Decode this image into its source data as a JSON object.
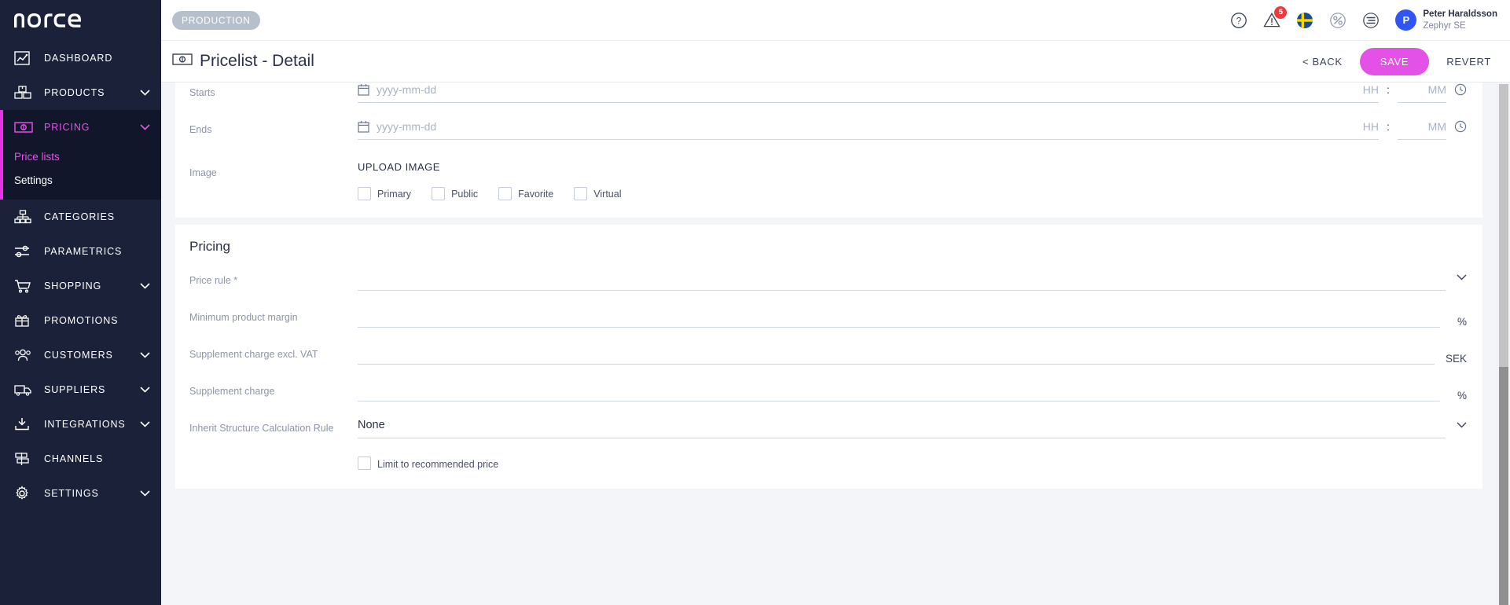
{
  "sidebar": {
    "logo": "norce",
    "items": [
      {
        "label": "DASHBOARD",
        "icon": "chart-line-icon",
        "expandable": false
      },
      {
        "label": "PRODUCTS",
        "icon": "boxes-icon",
        "expandable": true
      },
      {
        "label": "PRICING",
        "icon": "banknote-icon",
        "expandable": true,
        "active": true
      },
      {
        "label": "CATEGORIES",
        "icon": "sitemap-icon",
        "expandable": false
      },
      {
        "label": "PARAMETRICS",
        "icon": "sliders-icon",
        "expandable": false
      },
      {
        "label": "SHOPPING",
        "icon": "cart-icon",
        "expandable": true
      },
      {
        "label": "PROMOTIONS",
        "icon": "gift-icon",
        "expandable": false
      },
      {
        "label": "CUSTOMERS",
        "icon": "users-icon",
        "expandable": true
      },
      {
        "label": "SUPPLIERS",
        "icon": "truck-icon",
        "expandable": true
      },
      {
        "label": "INTEGRATIONS",
        "icon": "download-tray-icon",
        "expandable": true
      },
      {
        "label": "CHANNELS",
        "icon": "channels-icon",
        "expandable": false
      },
      {
        "label": "SETTINGS",
        "icon": "gear-icon",
        "expandable": true
      }
    ],
    "sub_items": [
      {
        "label": "Price lists",
        "selected": true
      },
      {
        "label": "Settings",
        "selected": false
      }
    ],
    "accent_color": "#e832e8",
    "background_color": "#1b2138"
  },
  "topbar": {
    "environment_badge": "PRODUCTION",
    "icons": [
      {
        "name": "help-icon",
        "glyph": "?"
      },
      {
        "name": "warning-icon",
        "badge": "5"
      },
      {
        "name": "flag-sweden-icon"
      },
      {
        "name": "percent-icon"
      },
      {
        "name": "stack-list-icon"
      }
    ],
    "notification_count": "5",
    "user": {
      "initial": "P",
      "name": "Peter Haraldsson",
      "organization": "Zephyr SE",
      "avatar_color": "#2f55f5"
    }
  },
  "pagebar": {
    "title": "Pricelist - Detail",
    "title_icon": "banknote-icon",
    "back_label": "< BACK",
    "save_label": "SAVE",
    "revert_label": "REVERT",
    "save_color": "#e451e7"
  },
  "form": {
    "schedule": [
      {
        "label": "Starts",
        "date_placeholder": "yyyy-mm-dd",
        "hour_placeholder": "HH",
        "separator": ":",
        "minute_placeholder": "MM"
      },
      {
        "label": "Ends",
        "date_placeholder": "yyyy-mm-dd",
        "hour_placeholder": "HH",
        "separator": ":",
        "minute_placeholder": "MM"
      }
    ],
    "image": {
      "label": "Image",
      "upload_label": "UPLOAD IMAGE",
      "checkboxes": [
        {
          "label": "Primary",
          "checked": false
        },
        {
          "label": "Public",
          "checked": false
        },
        {
          "label": "Favorite",
          "checked": false
        },
        {
          "label": "Virtual",
          "checked": false
        }
      ]
    }
  },
  "pricing": {
    "section_title": "Pricing",
    "fields": [
      {
        "label": "Price rule *",
        "value": "",
        "suffix": "",
        "type": "select"
      },
      {
        "label": "Minimum product margin",
        "value": "",
        "suffix": "%",
        "type": "text"
      },
      {
        "label": "Supplement charge excl. VAT",
        "value": "",
        "suffix": "SEK",
        "type": "text"
      },
      {
        "label": "Supplement charge",
        "value": "",
        "suffix": "%",
        "type": "text"
      },
      {
        "label": "Inherit Structure Calculation Rule",
        "value": "None",
        "suffix": "",
        "type": "select"
      }
    ],
    "limit_checkbox": {
      "label": "Limit to recommended price",
      "checked": false
    }
  }
}
